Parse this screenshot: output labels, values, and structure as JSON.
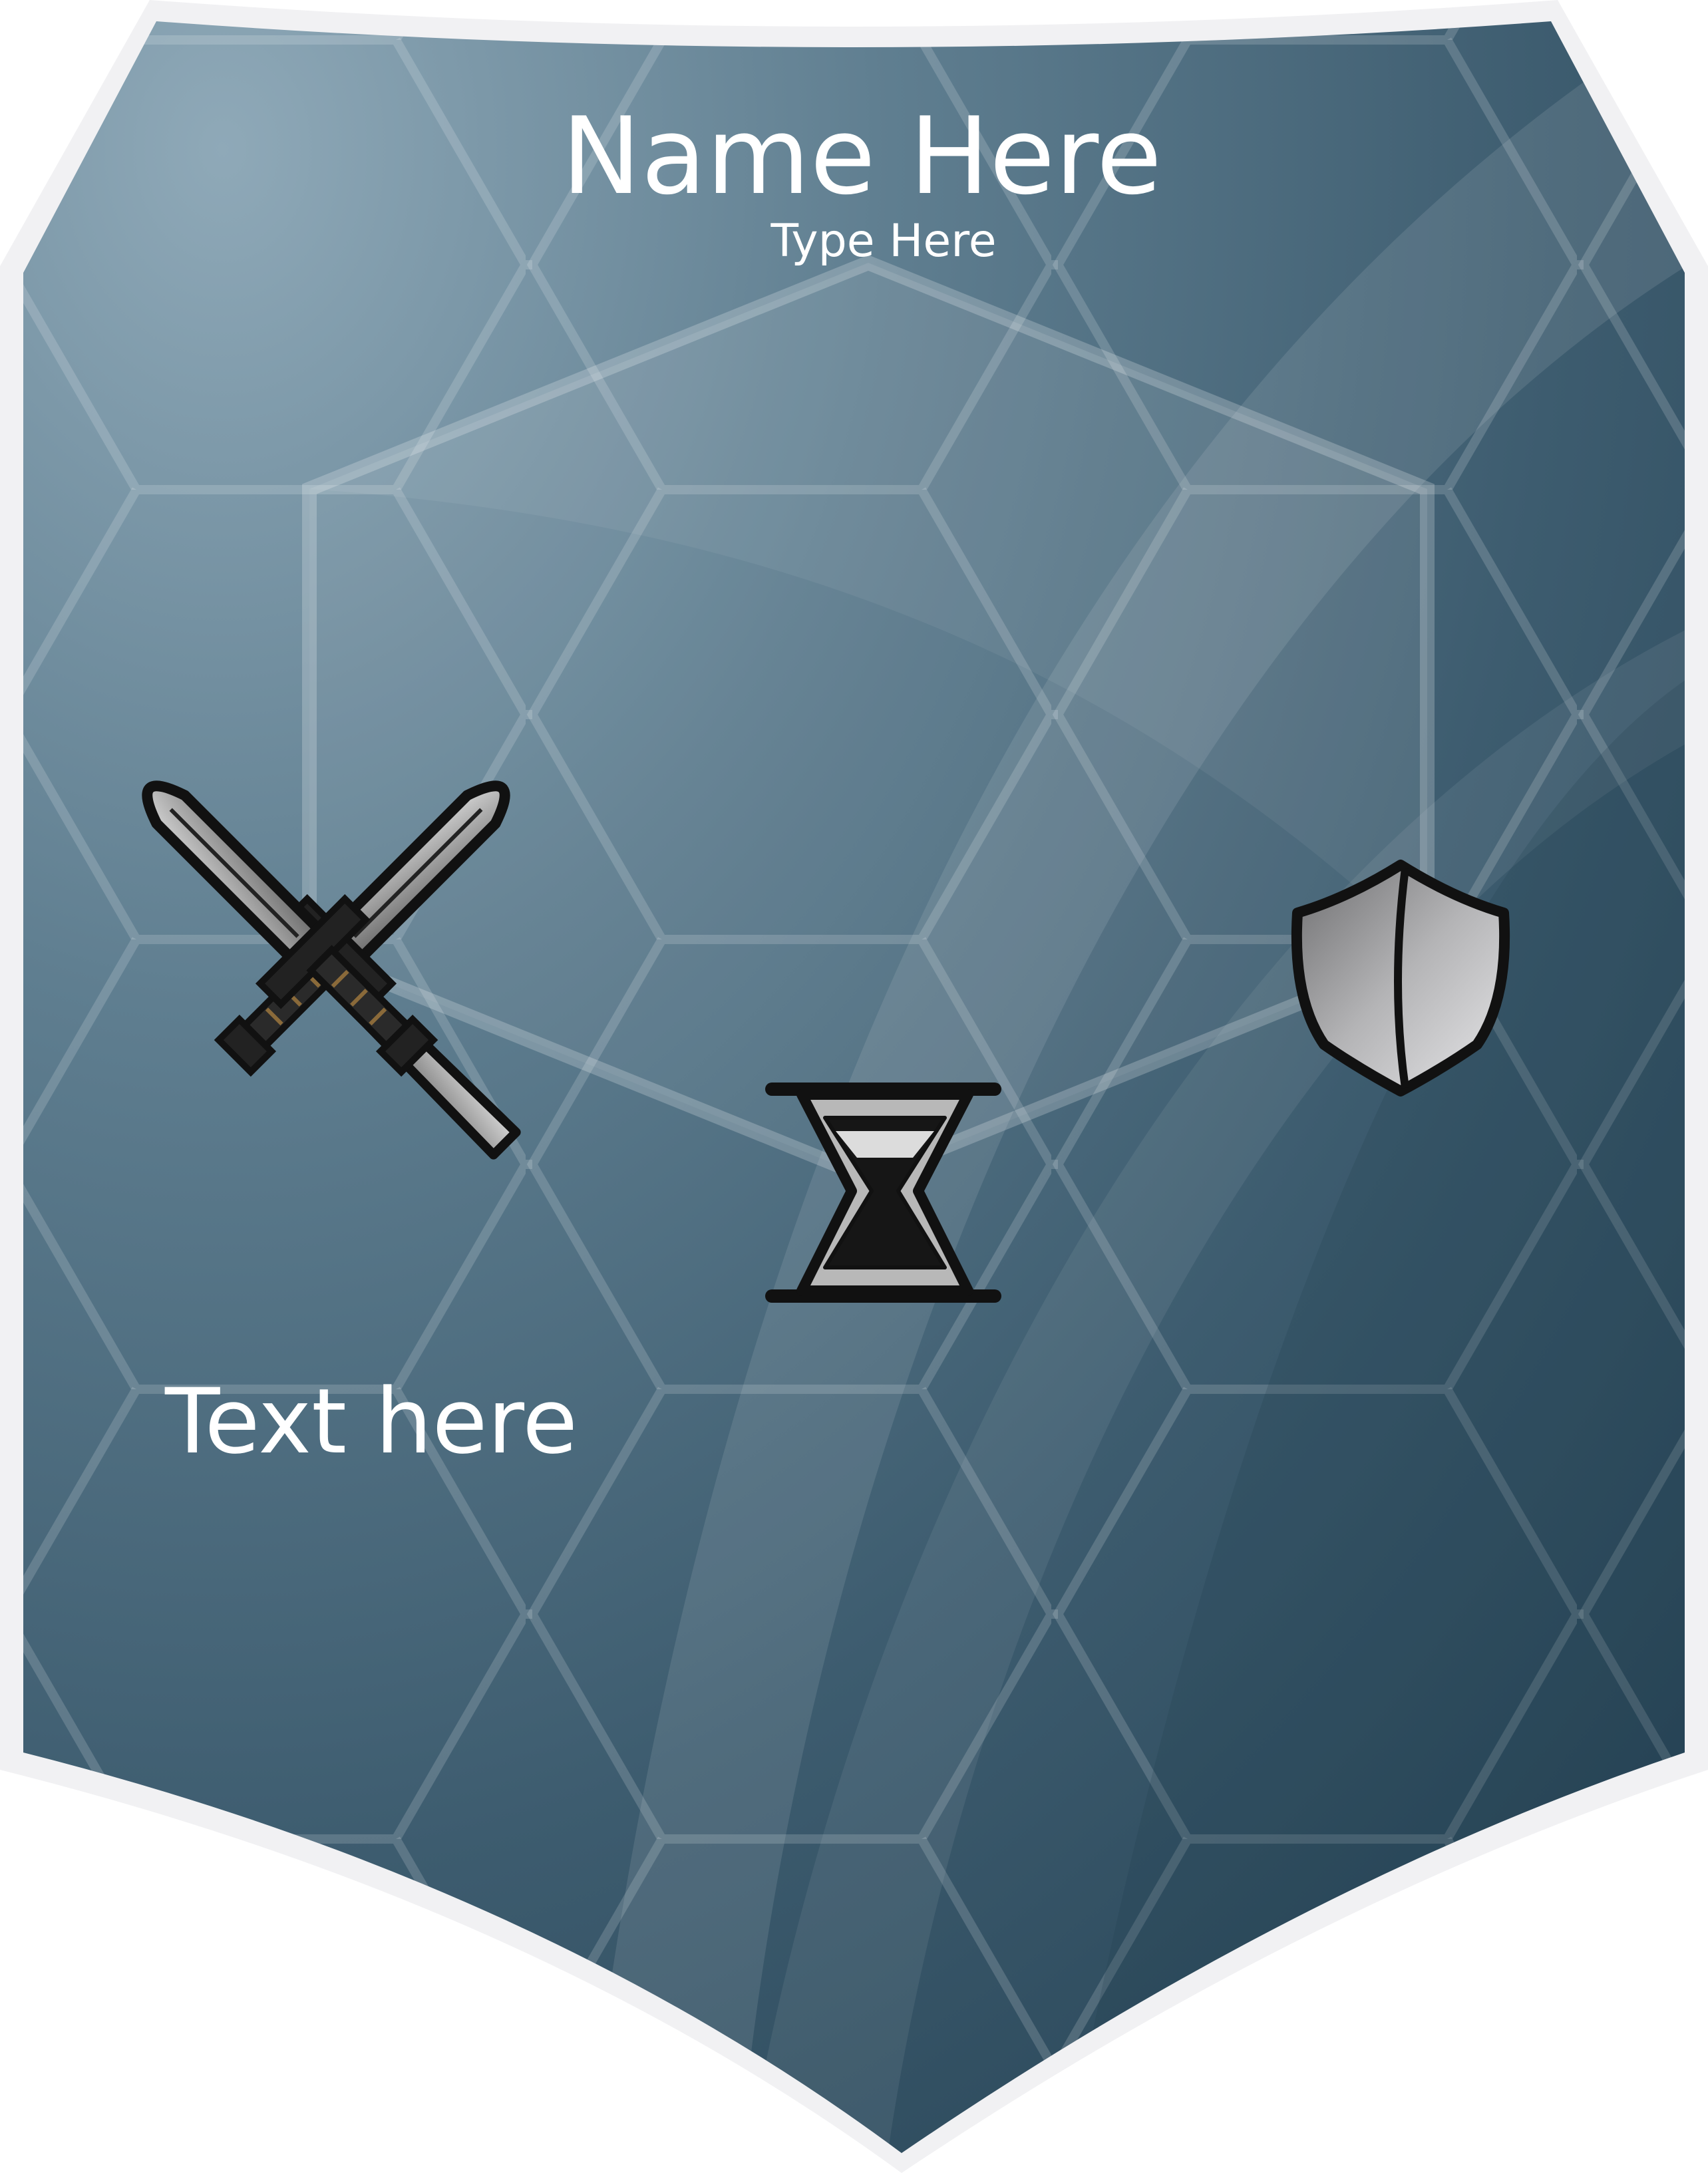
{
  "card": {
    "name": "Name Here",
    "type": "Type Here",
    "body_text": "Text here"
  },
  "icons": {
    "left": "crossed-swords-icon",
    "center": "hourglass-icon",
    "right": "shield-icon"
  },
  "colors": {
    "border": "#f1f1f3",
    "background_light": "#8aa4b4",
    "background_mid": "#5b7a8c",
    "background_dark": "#2c4b5e",
    "text": "#ffffff",
    "icon_outline": "#111111",
    "icon_metal": "#a8a8a8"
  }
}
